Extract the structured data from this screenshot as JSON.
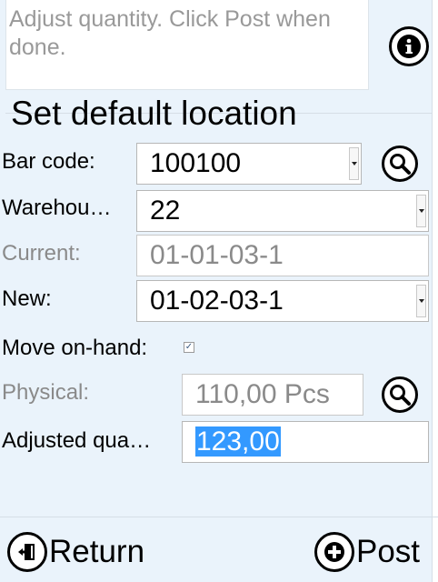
{
  "info": {
    "message": "Adjust quantity. Click Post when done."
  },
  "section": {
    "title": "Set default location"
  },
  "form": {
    "barcode_label": "Bar code:",
    "barcode_value": "100100",
    "warehouse_label": "Warehou…",
    "warehouse_value": "22",
    "current_label": "Current:",
    "current_value": "01-01-03-1",
    "new_label": "New:",
    "new_value": "01-02-03-1",
    "move_label": "Move on-hand:",
    "move_checked": true,
    "physical_label": "Physical:",
    "physical_value": "110,00 Pcs",
    "adjusted_label": "Adjusted qua…",
    "adjusted_value": "123,00"
  },
  "footer": {
    "return_label": "Return",
    "post_label": "Post"
  },
  "icons": {
    "info": "info-icon",
    "search": "magnifier-icon",
    "return": "exit-door-icon",
    "post": "plus-icon"
  }
}
